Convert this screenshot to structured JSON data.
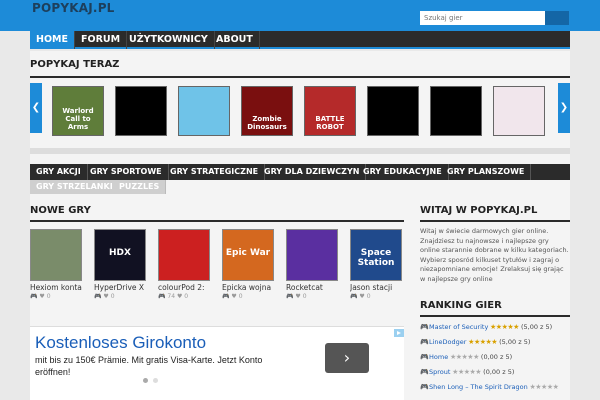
{
  "header": {
    "logo": "POPYKAJ.PL",
    "search_placeholder": "Szukaj gier"
  },
  "nav": {
    "items": [
      "HOME",
      "FORUM",
      "UŻYTKOWNICY",
      "ABOUT"
    ]
  },
  "featured": {
    "title": "POPYKAJ TERAZ",
    "thumbs": [
      {
        "caption": "Warlord Call to Arms",
        "color": "#5f7d3a"
      },
      {
        "caption": "",
        "color": "#000000"
      },
      {
        "caption": "",
        "color": "#6fc3e8"
      },
      {
        "caption": "Zombie Dinosaurs",
        "color": "#7a0f0f"
      },
      {
        "caption": "BATTLE ROBOT",
        "color": "#b52a2a"
      },
      {
        "caption": "",
        "color": "#000000"
      },
      {
        "caption": "",
        "color": "#000000"
      },
      {
        "caption": "",
        "color": "#f1e6ec"
      }
    ]
  },
  "categories": {
    "row1": [
      "GRY AKCJI",
      "GRY SPORTOWE",
      "GRY STRATEGICZNE",
      "GRY DLA DZIEWCZYN",
      "GRY EDUKACYJNE",
      "GRY PLANSZOWE"
    ],
    "row2": [
      "GRY STRZELANKI",
      "PUZZLES"
    ]
  },
  "new_games": {
    "title": "NOWE GRY",
    "games": [
      {
        "name": "Hexiom kontakt",
        "plays": "",
        "likes": "0",
        "color": "#7a8c6a",
        "label": ""
      },
      {
        "name": "HyperDrive X",
        "plays": "",
        "likes": "0",
        "color": "#111122",
        "label": "HDX"
      },
      {
        "name": "colourPod 2:",
        "plays": "74",
        "likes": "0",
        "color": "#cc2020",
        "label": ""
      },
      {
        "name": "Epicka wojna",
        "plays": "",
        "likes": "0",
        "color": "#d4681f",
        "label": "Epic War"
      },
      {
        "name": "Rocketcat",
        "plays": "",
        "likes": "0",
        "color": "#5a2fa0",
        "label": ""
      },
      {
        "name": "Jason stacji",
        "plays": "",
        "likes": "0",
        "color": "#204a8c",
        "label": "Space Station"
      }
    ]
  },
  "ad": {
    "title": "Kostenloses Girokonto",
    "text": "mit bis zu 150€ Prämie. Mit gratis Visa-Karte. Jetzt Konto eröffnen!",
    "button": "›"
  },
  "sidebar": {
    "welcome_title": "WITAJ W POPYKAJ.PL",
    "welcome_text": "Witaj w świecie darmowych gier online. Znajdziesz tu najnowsze i najlepsze gry online starannie dobrane w kilku kategoriach. Wybierz sposród kilkuset tytułów i zagraj o niezapomniane emocje! Zrelaksuj się grając w najlepsze gry online",
    "ranking_title": "RANKING GIER",
    "ranking": [
      {
        "title": "Master of Security",
        "rating": 5,
        "value": "(5,00 z 5)"
      },
      {
        "title": "LineDodger",
        "rating": 5,
        "value": "(5,00 z 5)"
      },
      {
        "title": "Home",
        "rating": 0,
        "value": "(0,00 z 5)"
      },
      {
        "title": "Sprout",
        "rating": 0,
        "value": "(0,00 z 5)"
      },
      {
        "title": "Shen Long – The Spirit Dragon",
        "rating": 0,
        "value": ""
      }
    ]
  },
  "colors": {
    "accent": "#1d8bd8",
    "dark": "#2b2b2b",
    "star": "#d9a100"
  }
}
